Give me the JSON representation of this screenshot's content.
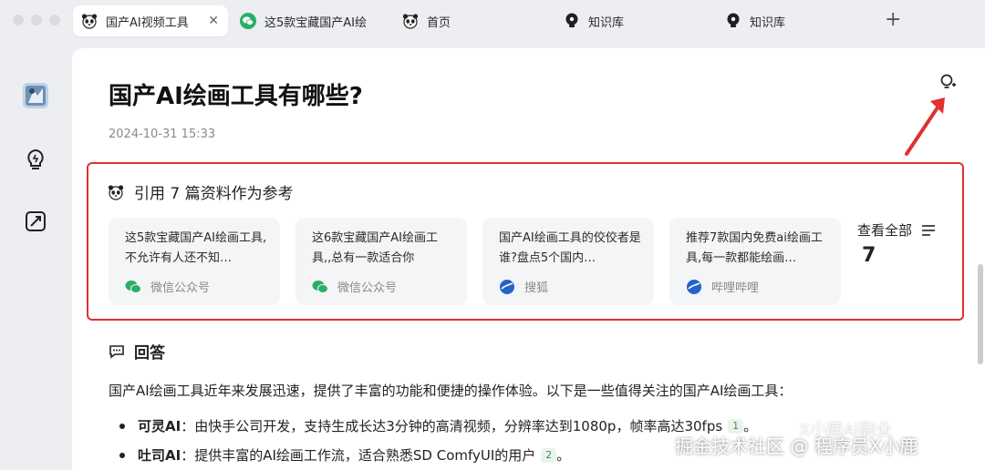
{
  "tabs": [
    {
      "label": "国产AI视频工具",
      "icon": "panda-icon",
      "active": true
    },
    {
      "label": "这5款宝藏国产AI绘",
      "icon": "wechat-icon",
      "active": false
    },
    {
      "label": "首页",
      "icon": "panda-icon",
      "active": false
    },
    {
      "label": "知识库",
      "icon": "bulb-icon",
      "active": false
    },
    {
      "label": "知识库",
      "icon": "bulb-icon",
      "active": false
    }
  ],
  "new_tab_label": "+",
  "close_label": "✕",
  "page": {
    "title": "国产AI绘画工具有哪些?",
    "date": "2024-10-31 15:33"
  },
  "references": {
    "heading": "引用 7 篇资料作为参考",
    "items": [
      {
        "text": "这5款宝藏国产AI绘画工具,不允许有人还不知…",
        "source": "微信公众号",
        "icon": "wechat-icon"
      },
      {
        "text": "这6款宝藏国产AI绘画工具,,总有一款适合你",
        "source": "微信公众号",
        "icon": "wechat-icon"
      },
      {
        "text": "国产AI绘画工具的佼佼者是谁?盘点5个国内…",
        "source": "搜狐",
        "icon": "sohu-icon"
      },
      {
        "text": "推荐7款国内免费ai绘画工具,每一款都能绘画…",
        "source": "哔哩哔哩",
        "icon": "bilibili-icon"
      }
    ],
    "view_all_label": "查看全部",
    "view_all_count": "7"
  },
  "answer": {
    "heading": "回答",
    "intro": "国产AI绘画工具近年来发展迅速，提供了丰富的功能和便捷的操作体验。以下是一些值得关注的国产AI绘画工具：",
    "bullets": [
      {
        "name": "可灵AI",
        "desc": "：由快手公司开发，支持生成长达3分钟的高清视频，分辨率达到1080p，帧率高达30fps",
        "cite": "1",
        "tail": "。"
      },
      {
        "name": "吐司AI",
        "desc": "：提供丰富的AI绘画工作流，适合熟悉SD ComfyUI的用户",
        "cite": "2",
        "tail": "。"
      }
    ]
  },
  "watermark": {
    "main": "掘金技术社区 @ 程序员X小鹿",
    "faint": "X小鹿AI副业"
  },
  "colors": {
    "highlight_border": "#e03131",
    "wechat_green": "#2aae67",
    "citation_bg": "#e8f4ec"
  }
}
